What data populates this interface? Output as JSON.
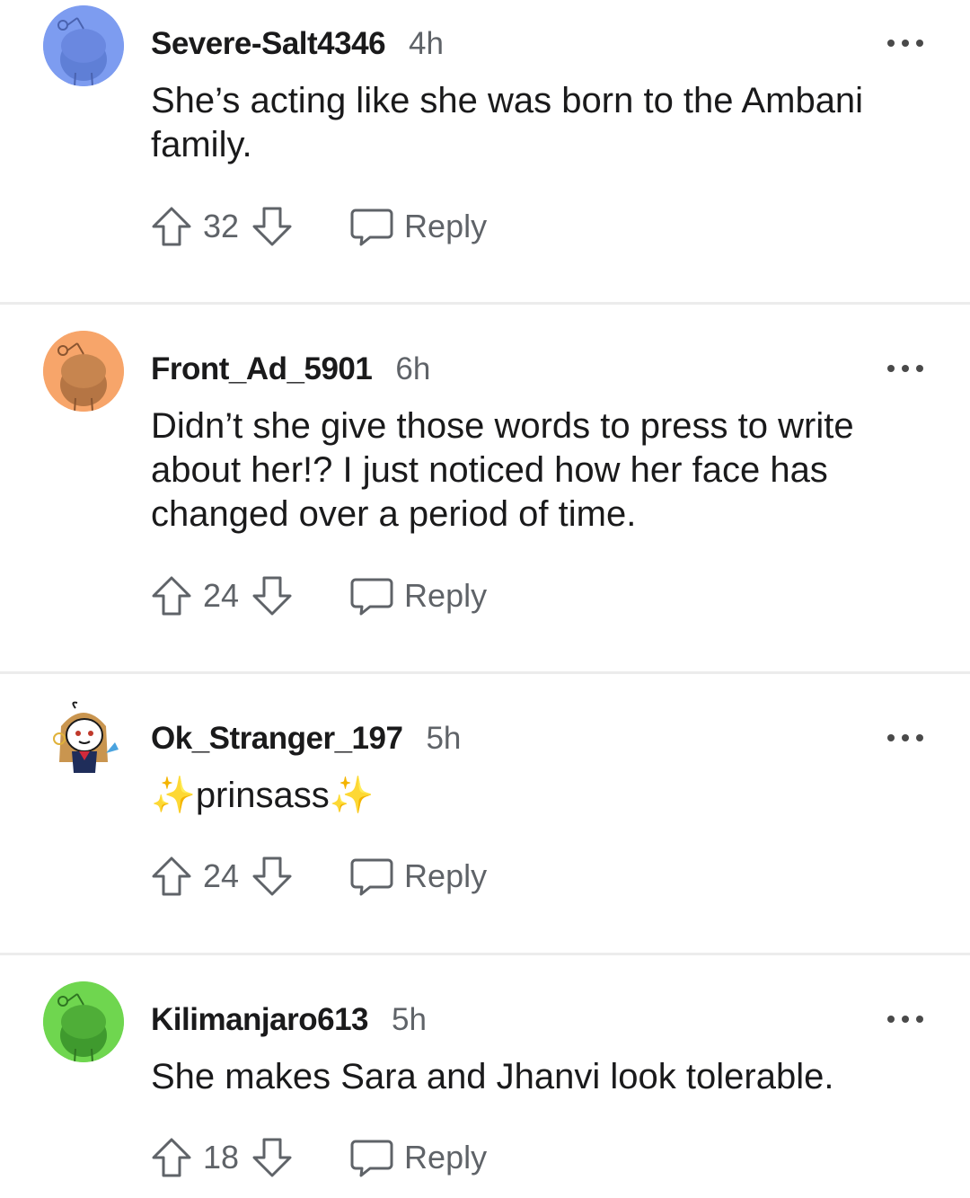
{
  "comments": [
    {
      "username": "Severe-Salt4346",
      "time": "4h",
      "text": "She’s acting like she was born to the Ambani family.",
      "score": "32",
      "reply_label": "Reply",
      "avatar_color": "#7d9cf0",
      "avatar_icon": "snoo-avatar-blue"
    },
    {
      "username": "Front_Ad_5901",
      "time": "6h",
      "text": "Didn’t she give those words to press to write about her!? I just noticed how her face has changed over a period of time.",
      "score": "24",
      "reply_label": "Reply",
      "avatar_color": "#f7a56a",
      "avatar_icon": "snoo-avatar-orange"
    },
    {
      "username": "Ok_Stranger_197",
      "time": "5h",
      "text_prefix": "✨",
      "text": "prinsass",
      "text_suffix": "✨",
      "score": "24",
      "reply_label": "Reply",
      "avatar_icon": "custom-snoo-avatar"
    },
    {
      "username": "Kilimanjaro613",
      "time": "5h",
      "text": "She makes Sara and Jhanvi look tolerable.",
      "score": "18",
      "reply_label": "Reply",
      "avatar_color": "#6fd64f",
      "avatar_icon": "snoo-avatar-green"
    }
  ],
  "colors": {
    "text_primary": "#1a1a1b",
    "text_secondary": "#5f6368",
    "divider": "#ececec",
    "icon": "#5f6368"
  }
}
